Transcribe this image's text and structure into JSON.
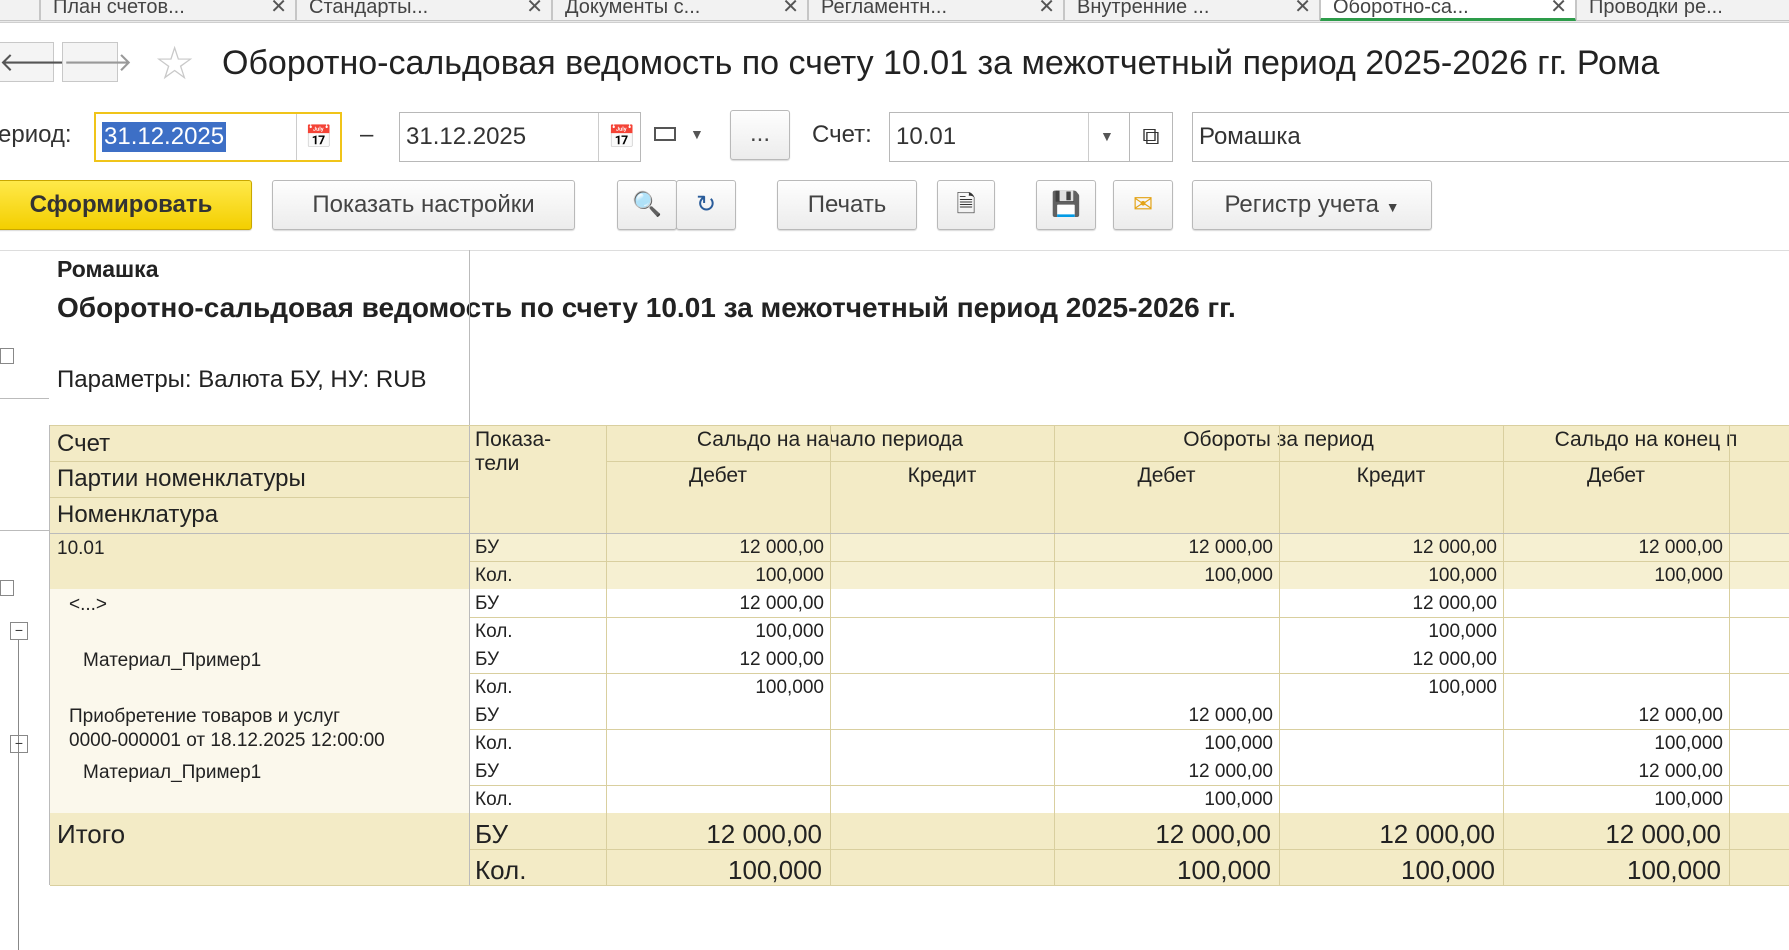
{
  "tabs": [
    {
      "label": "План счетов..."
    },
    {
      "label": "Стандарты..."
    },
    {
      "label": "Документы с..."
    },
    {
      "label": "Регламентн..."
    },
    {
      "label": "Внутренние ..."
    },
    {
      "label": "Оборотно-са..."
    },
    {
      "label": "Проводки ре..."
    }
  ],
  "header": {
    "title": "Оборотно-сальдовая ведомость по счету 10.01 за межотчетный период 2025-2026 гг. Рома"
  },
  "filters": {
    "period_label": "ериод:",
    "date_from": "31.12.2025",
    "dash": "–",
    "date_to": "31.12.2025",
    "dots_label": "...",
    "account_label": "Счет:",
    "account_value": "10.01",
    "org_value": "Ромашка"
  },
  "toolbar": {
    "generate": "Сформировать",
    "show_settings": "Показать настройки",
    "print": "Печать",
    "register": "Регистр учета"
  },
  "report": {
    "org": "Ромашка",
    "title": "Оборотно-сальдовая ведомость по счету 10.01 за межотчетный период 2025-2026 гг.",
    "params": "Параметры:   Валюта БУ, НУ: RUB",
    "col_account": "Счет",
    "col_batches": "Партии номенклатуры",
    "col_nomenclature": "Номенклатура",
    "col_indicators": "Показа-\nтели",
    "grp_opening": "Сальдо на начало периода",
    "grp_turnover": "Обороты за период",
    "grp_closing": "Сальдо на конец п",
    "debit": "Дебет",
    "credit": "Кредит",
    "rows": [
      {
        "name": "10.01",
        "bu": [
          "12 000,00",
          "",
          "12 000,00",
          "12 000,00",
          "12 000,00"
        ],
        "qty": [
          "100,000",
          "",
          "100,000",
          "100,000",
          "100,000"
        ]
      },
      {
        "name": "<...>",
        "bu": [
          "12 000,00",
          "",
          "",
          "12 000,00",
          ""
        ],
        "qty": [
          "100,000",
          "",
          "",
          "100,000",
          ""
        ]
      },
      {
        "name": "Материал_Пример1",
        "bu": [
          "12 000,00",
          "",
          "",
          "12 000,00",
          ""
        ],
        "qty": [
          "100,000",
          "",
          "",
          "100,000",
          ""
        ]
      },
      {
        "name": "Приобретение товаров и услуг\n0000-000001 от 18.12.2025 12:00:00",
        "bu": [
          "",
          "",
          "12 000,00",
          "",
          "12 000,00"
        ],
        "qty": [
          "",
          "",
          "100,000",
          "",
          "100,000"
        ]
      },
      {
        "name": "Материал_Пример1",
        "bu": [
          "",
          "",
          "12 000,00",
          "",
          "12 000,00"
        ],
        "qty": [
          "",
          "",
          "100,000",
          "",
          "100,000"
        ]
      }
    ],
    "bu_label": "БУ",
    "qty_label": "Кол.",
    "total": {
      "name": "Итого",
      "bu": [
        "12 000,00",
        "",
        "12 000,00",
        "12 000,00",
        "12 000,00"
      ],
      "qty": [
        "100,000",
        "",
        "100,000",
        "100,000",
        "100,000"
      ]
    }
  },
  "colors": {
    "accent_green": "#2d9c4a",
    "primary_yellow": "#f3cf00",
    "header_bg": "#f3ebc6"
  }
}
